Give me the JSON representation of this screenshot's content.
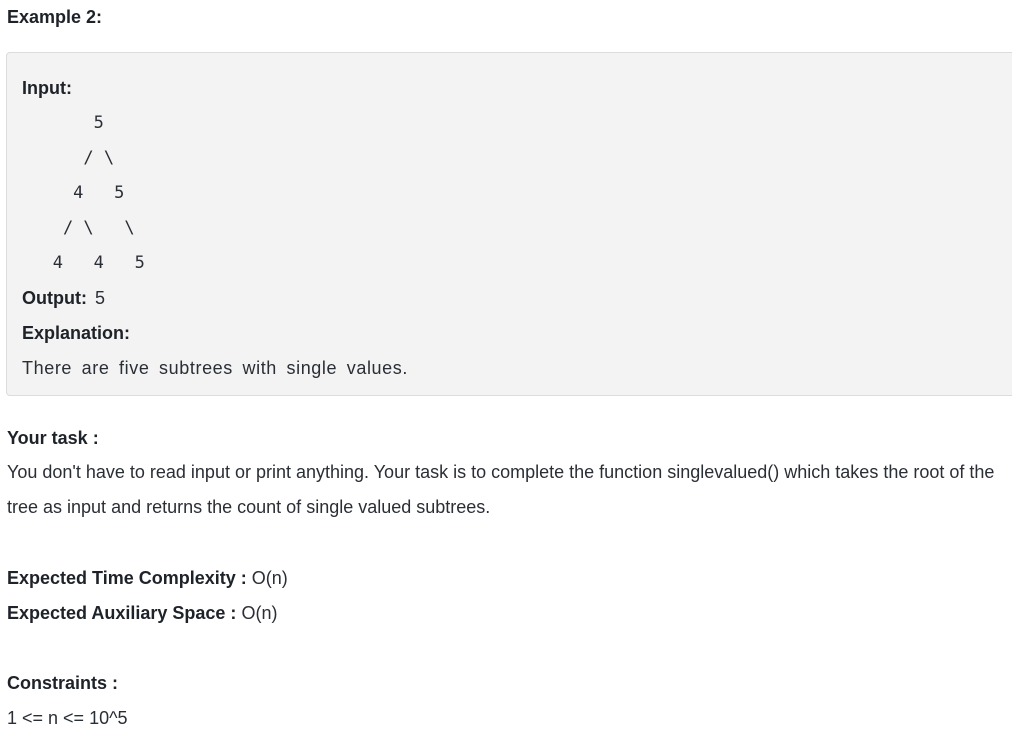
{
  "example": {
    "heading": "Example 2:",
    "input_label": "Input:",
    "tree": [
      "       5",
      "      / \\",
      "     4   5",
      "    / \\   \\",
      "   4   4   5"
    ],
    "output_label": "Output:",
    "output_value": "5",
    "explanation_label": "Explanation:",
    "explanation_text": "There are five subtrees with single values."
  },
  "task": {
    "title": "Your task :",
    "description": "You don't have to read input or print anything. Your task is to complete the function singlevalued() which takes the root of the tree as input and returns the count of single valued subtrees."
  },
  "complexity": {
    "time_label": "Expected Time Complexity :",
    "time_value": "O(n)",
    "space_label": "Expected Auxiliary Space :",
    "space_value": "O(n)"
  },
  "constraints": {
    "title": "Constraints :",
    "value": "1 <= n <= 10^5"
  }
}
